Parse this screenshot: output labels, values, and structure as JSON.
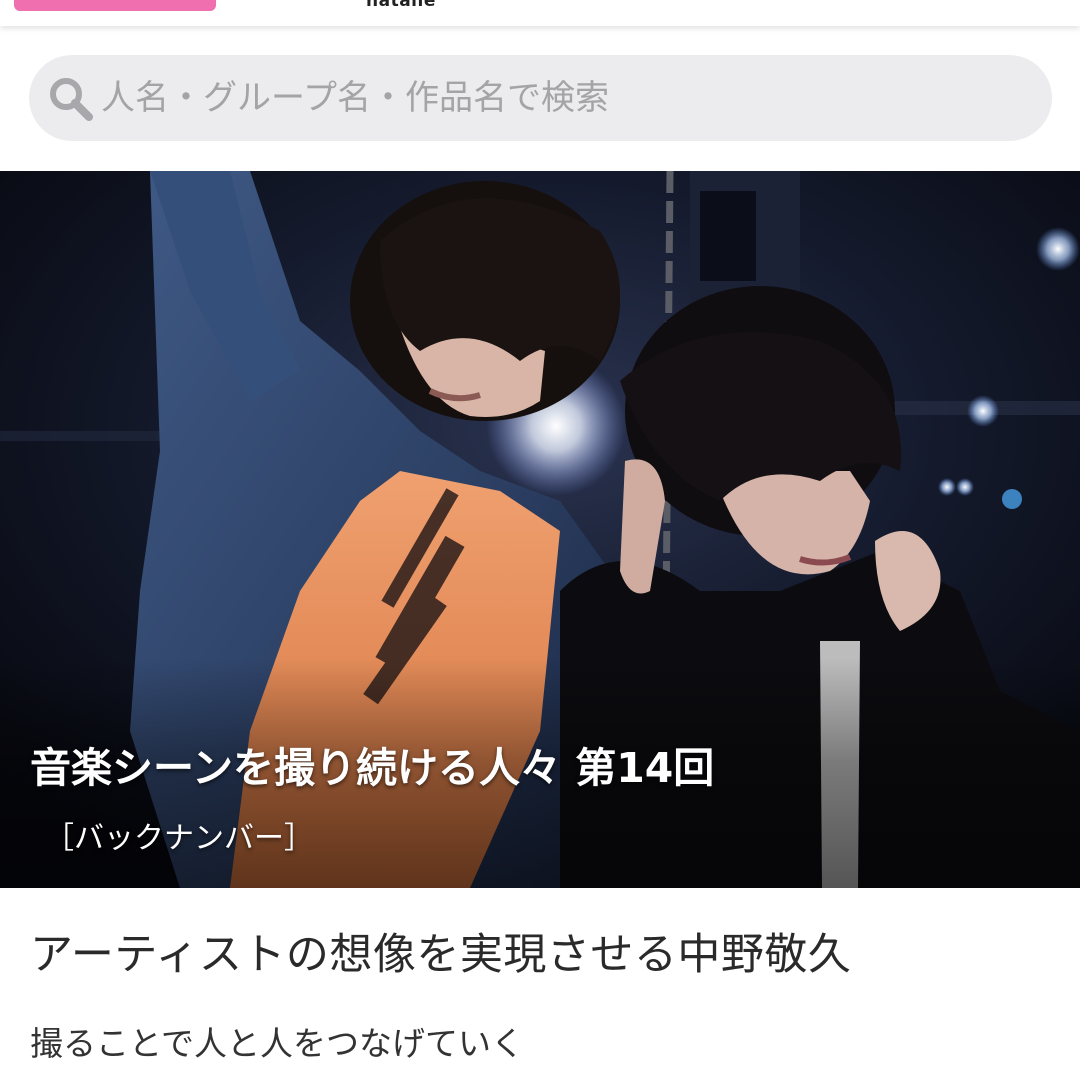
{
  "header": {
    "logo_text": "natalie",
    "accent_color": "#f06fae"
  },
  "search": {
    "placeholder": "人名・グループ名・作品名で検索",
    "icon": "search-icon"
  },
  "hero": {
    "title": "音楽シーンを撮り続ける人々 第14回",
    "backnumber_label": "［バックナンバー］",
    "image_description_icon": "photo"
  },
  "article": {
    "title": "アーティストの想像を実現させる中野敬久",
    "subtitle": "撮ることで人と人をつなげていく"
  }
}
